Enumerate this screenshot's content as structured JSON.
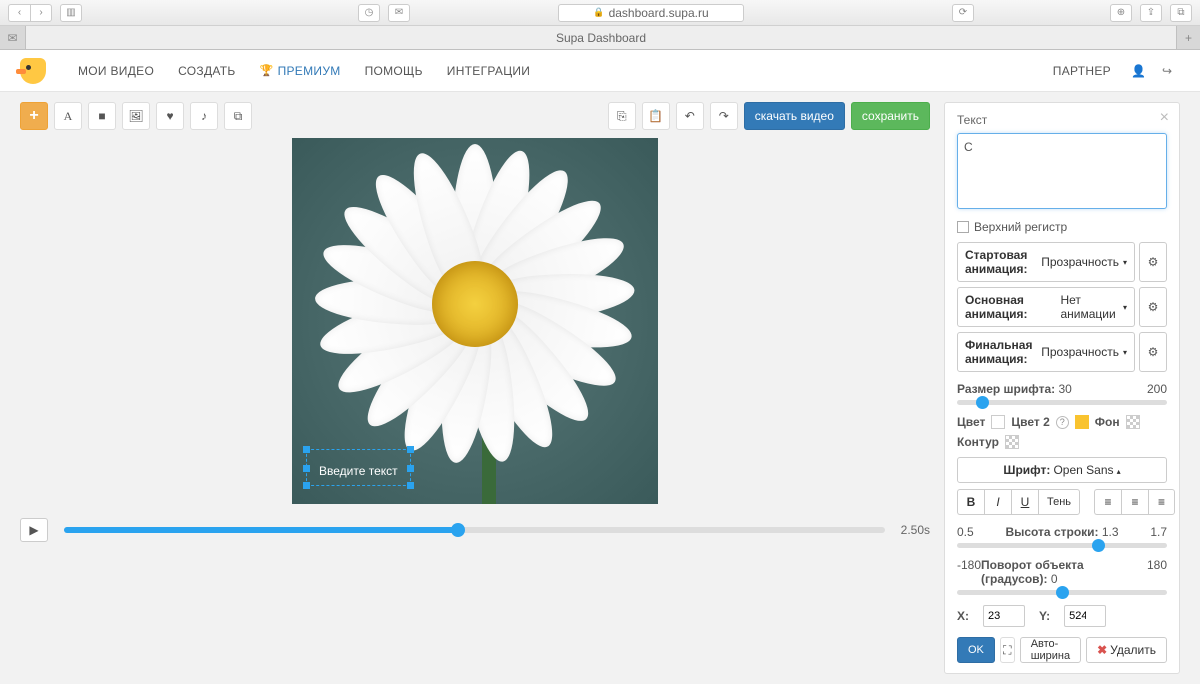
{
  "browser": {
    "url": "dashboard.supa.ru",
    "tab_title": "Supa Dashboard"
  },
  "nav": {
    "items": [
      "МОИ ВИДЕО",
      "СОЗДАТЬ",
      "ПРЕМИУМ",
      "ПОМОЩЬ",
      "ИНТЕГРАЦИИ"
    ],
    "partner": "ПАРТНЕР"
  },
  "toolbar": {
    "download": "скачать видео",
    "save": "сохранить"
  },
  "canvas": {
    "placeholder_text": "Введите текст"
  },
  "timeline": {
    "duration": "2.50s"
  },
  "panel": {
    "title": "Текст",
    "text_value": "С",
    "uppercase": "Верхний регистр",
    "anim_start_label": "Стартовая анимация:",
    "anim_start_value": "Прозрачность",
    "anim_main_label": "Основная анимация:",
    "anim_main_value": "Нет анимации",
    "anim_end_label": "Финальная анимация:",
    "anim_end_value": "Прозрачность",
    "font_size_label": "Размер шрифта:",
    "font_size_value": "30",
    "font_size_max": "200",
    "color_label": "Цвет",
    "color2_label": "Цвет 2",
    "bg_label": "Фон",
    "outline_label": "Контур",
    "font_label": "Шрифт:",
    "font_value": "Open Sans",
    "shadow": "Тень",
    "lh_min": "0.5",
    "lh_label": "Высота строки:",
    "lh_value": "1.3",
    "lh_max": "1.7",
    "rot_min": "-180",
    "rot_label": "Поворот объекта (градусов):",
    "rot_value": "0",
    "rot_max": "180",
    "x_label": "X:",
    "x_value": "23",
    "y_label": "Y:",
    "y_value": "524",
    "ok": "OK",
    "autowidth": "Авто-ширина",
    "delete": "Удалить"
  }
}
